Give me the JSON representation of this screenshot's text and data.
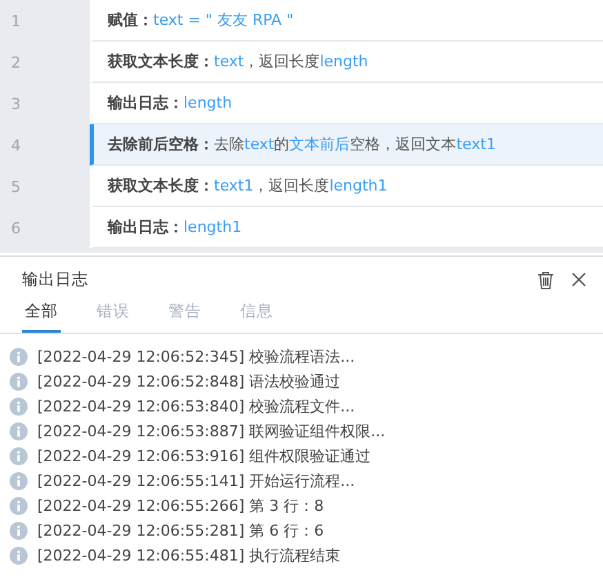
{
  "steps": [
    {
      "number": "1",
      "selected": false,
      "label": "赋值：",
      "parts": [
        {
          "kind": "var",
          "text": "text = \" 友友 RPA \""
        }
      ]
    },
    {
      "number": "2",
      "selected": false,
      "label": "获取文本长度：",
      "parts": [
        {
          "kind": "var",
          "text": "text"
        },
        {
          "kind": "plain",
          "text": "，返回长度 "
        },
        {
          "kind": "var",
          "text": "length"
        }
      ]
    },
    {
      "number": "3",
      "selected": false,
      "label": "输出日志：",
      "parts": [
        {
          "kind": "var",
          "text": "length"
        }
      ]
    },
    {
      "number": "4",
      "selected": true,
      "label": "去除前后空格：",
      "parts": [
        {
          "kind": "plain",
          "text": "去除 "
        },
        {
          "kind": "var",
          "text": "text"
        },
        {
          "kind": "plain",
          "text": " 的"
        },
        {
          "kind": "var",
          "text": "文本前后"
        },
        {
          "kind": "plain",
          "text": "空格，返回文本 "
        },
        {
          "kind": "var",
          "text": "text1"
        }
      ]
    },
    {
      "number": "5",
      "selected": false,
      "label": "获取文本长度：",
      "parts": [
        {
          "kind": "var",
          "text": "text1"
        },
        {
          "kind": "plain",
          "text": "，返回长度 "
        },
        {
          "kind": "var",
          "text": "length1"
        }
      ]
    },
    {
      "number": "6",
      "selected": false,
      "label": "输出日志：",
      "parts": [
        {
          "kind": "var",
          "text": "length1"
        }
      ]
    }
  ],
  "log_panel": {
    "title": "输出日志",
    "tabs": [
      {
        "label": "全部",
        "selected": true
      },
      {
        "label": "错误",
        "selected": false
      },
      {
        "label": "警告",
        "selected": false
      },
      {
        "label": "信息",
        "selected": false
      }
    ],
    "entries": [
      "[2022-04-29 12:06:52:345] 校验流程语法...",
      "[2022-04-29 12:06:52:848] 语法校验通过",
      "[2022-04-29 12:06:53:840] 校验流程文件...",
      "[2022-04-29 12:06:53:887] 联网验证组件权限...",
      "[2022-04-29 12:06:53:916] 组件权限验证通过",
      "[2022-04-29 12:06:55:141] 开始运行流程...",
      "[2022-04-29 12:06:55:266] 第 3 行：8",
      "[2022-04-29 12:06:55:281] 第 6 行：6",
      "[2022-04-29 12:06:55:481] 执行流程结束"
    ]
  }
}
